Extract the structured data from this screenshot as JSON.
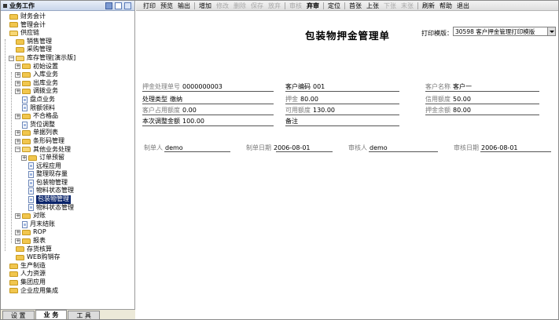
{
  "left_panel": {
    "title": "业务工作",
    "tree": [
      {
        "label": "财务会计",
        "level": 0,
        "icon": "folder",
        "exp": ""
      },
      {
        "label": "管理会计",
        "level": 0,
        "icon": "folder",
        "exp": ""
      },
      {
        "label": "供应链",
        "level": 0,
        "icon": "folder-open",
        "exp": ""
      },
      {
        "label": "销售管理",
        "level": 1,
        "icon": "folder",
        "exp": ""
      },
      {
        "label": "采购管理",
        "level": 1,
        "icon": "folder",
        "exp": ""
      },
      {
        "label": "库存管理[演示版]",
        "level": 1,
        "icon": "folder-open",
        "exp": "−"
      },
      {
        "label": "初始设置",
        "level": 2,
        "icon": "folder",
        "exp": "+"
      },
      {
        "label": "入库业务",
        "level": 2,
        "icon": "folder",
        "exp": "+"
      },
      {
        "label": "出库业务",
        "level": 2,
        "icon": "folder",
        "exp": "+"
      },
      {
        "label": "调拨业务",
        "level": 2,
        "icon": "folder",
        "exp": "+"
      },
      {
        "label": "盘点业务",
        "level": 2,
        "icon": "page",
        "exp": ""
      },
      {
        "label": "限额领料",
        "level": 2,
        "icon": "page",
        "exp": ""
      },
      {
        "label": "不合格品",
        "level": 2,
        "icon": "folder",
        "exp": "+"
      },
      {
        "label": "货位调整",
        "level": 2,
        "icon": "page",
        "exp": ""
      },
      {
        "label": "单据列表",
        "level": 2,
        "icon": "folder",
        "exp": "+"
      },
      {
        "label": "条形码管理",
        "level": 2,
        "icon": "folder",
        "exp": "+"
      },
      {
        "label": "其他业务处理",
        "level": 2,
        "icon": "folder-open",
        "exp": "−"
      },
      {
        "label": "订单预留",
        "level": 3,
        "icon": "folder",
        "exp": "+"
      },
      {
        "label": "远程应用",
        "level": 3,
        "icon": "page",
        "exp": ""
      },
      {
        "label": "整理现存量",
        "level": 3,
        "icon": "page",
        "exp": ""
      },
      {
        "label": "包装物管理",
        "level": 3,
        "icon": "page",
        "exp": ""
      },
      {
        "label": "物料状态管理",
        "level": 3,
        "icon": "page",
        "exp": ""
      },
      {
        "label": "包装物管理",
        "level": 3,
        "icon": "page",
        "exp": "",
        "selected": true
      },
      {
        "label": "物料状态管理",
        "level": 3,
        "icon": "page",
        "exp": ""
      },
      {
        "label": "对账",
        "level": 2,
        "icon": "folder",
        "exp": "+"
      },
      {
        "label": "月末结账",
        "level": 2,
        "icon": "page",
        "exp": ""
      },
      {
        "label": "ROP",
        "level": 2,
        "icon": "folder",
        "exp": "+"
      },
      {
        "label": "报表",
        "level": 2,
        "icon": "folder",
        "exp": "+"
      },
      {
        "label": "存货核算",
        "level": 1,
        "icon": "folder",
        "exp": ""
      },
      {
        "label": "WEB购销存",
        "level": 1,
        "icon": "folder",
        "exp": ""
      },
      {
        "label": "生产制造",
        "level": 0,
        "icon": "folder",
        "exp": ""
      },
      {
        "label": "人力资源",
        "level": 0,
        "icon": "folder",
        "exp": ""
      },
      {
        "label": "集团应用",
        "level": 0,
        "icon": "folder",
        "exp": ""
      },
      {
        "label": "企业应用集成",
        "level": 0,
        "icon": "folder",
        "exp": ""
      }
    ],
    "tabs": [
      "设 置",
      "业 务",
      "工 具"
    ],
    "active_tab": 1
  },
  "toolbar": [
    {
      "label": "打印",
      "enabled": true
    },
    {
      "label": "预览",
      "enabled": true
    },
    {
      "label": "输出",
      "enabled": true
    },
    {
      "sep": true
    },
    {
      "label": "增加",
      "enabled": true
    },
    {
      "label": "修改",
      "enabled": false
    },
    {
      "label": "删除",
      "enabled": false
    },
    {
      "label": "保存",
      "enabled": false
    },
    {
      "label": "放弃",
      "enabled": false
    },
    {
      "sep": true
    },
    {
      "label": "审核",
      "enabled": false
    },
    {
      "label": "弃审",
      "enabled": true,
      "bold": true
    },
    {
      "sep": true
    },
    {
      "label": "定位",
      "enabled": true
    },
    {
      "sep": true
    },
    {
      "label": "首张",
      "enabled": true
    },
    {
      "label": "上张",
      "enabled": true
    },
    {
      "label": "下张",
      "enabled": false
    },
    {
      "label": "末张",
      "enabled": false
    },
    {
      "sep": true
    },
    {
      "label": "刷新",
      "enabled": true
    },
    {
      "label": "帮助",
      "enabled": true
    },
    {
      "label": "退出",
      "enabled": true
    }
  ],
  "document": {
    "title": "包装物押金管理单",
    "print_template_label": "打印模版：",
    "print_template_value": "30598 客户押金管理打印模版",
    "fields": {
      "deposit_no": {
        "label": "押金处理单号",
        "value": "0000000003"
      },
      "customer_code": {
        "label": "客户编码",
        "value": "001"
      },
      "customer_name": {
        "label": "客户名称",
        "value": "客户一"
      },
      "process_type": {
        "label": "处理类型",
        "value": "缴纳"
      },
      "deposit": {
        "label": "押金",
        "value": "80.00"
      },
      "credit_limit": {
        "label": "信用额度",
        "value": "50.00"
      },
      "used_limit": {
        "label": "客户占用额度",
        "value": "0.00"
      },
      "available_limit": {
        "label": "可用额度",
        "value": "130.00"
      },
      "deposit_balance": {
        "label": "押金余额",
        "value": "80.00"
      },
      "adjust_amount": {
        "label": "本次调整金额",
        "value": "100.00"
      },
      "remark": {
        "label": "备注",
        "value": ""
      },
      "creator": {
        "label": "制单人",
        "value": "demo"
      },
      "create_date": {
        "label": "制单日期",
        "value": "2006-08-01"
      },
      "auditor": {
        "label": "审核人",
        "value": "demo"
      },
      "audit_date": {
        "label": "审核日期",
        "value": "2006-08-01"
      }
    }
  }
}
